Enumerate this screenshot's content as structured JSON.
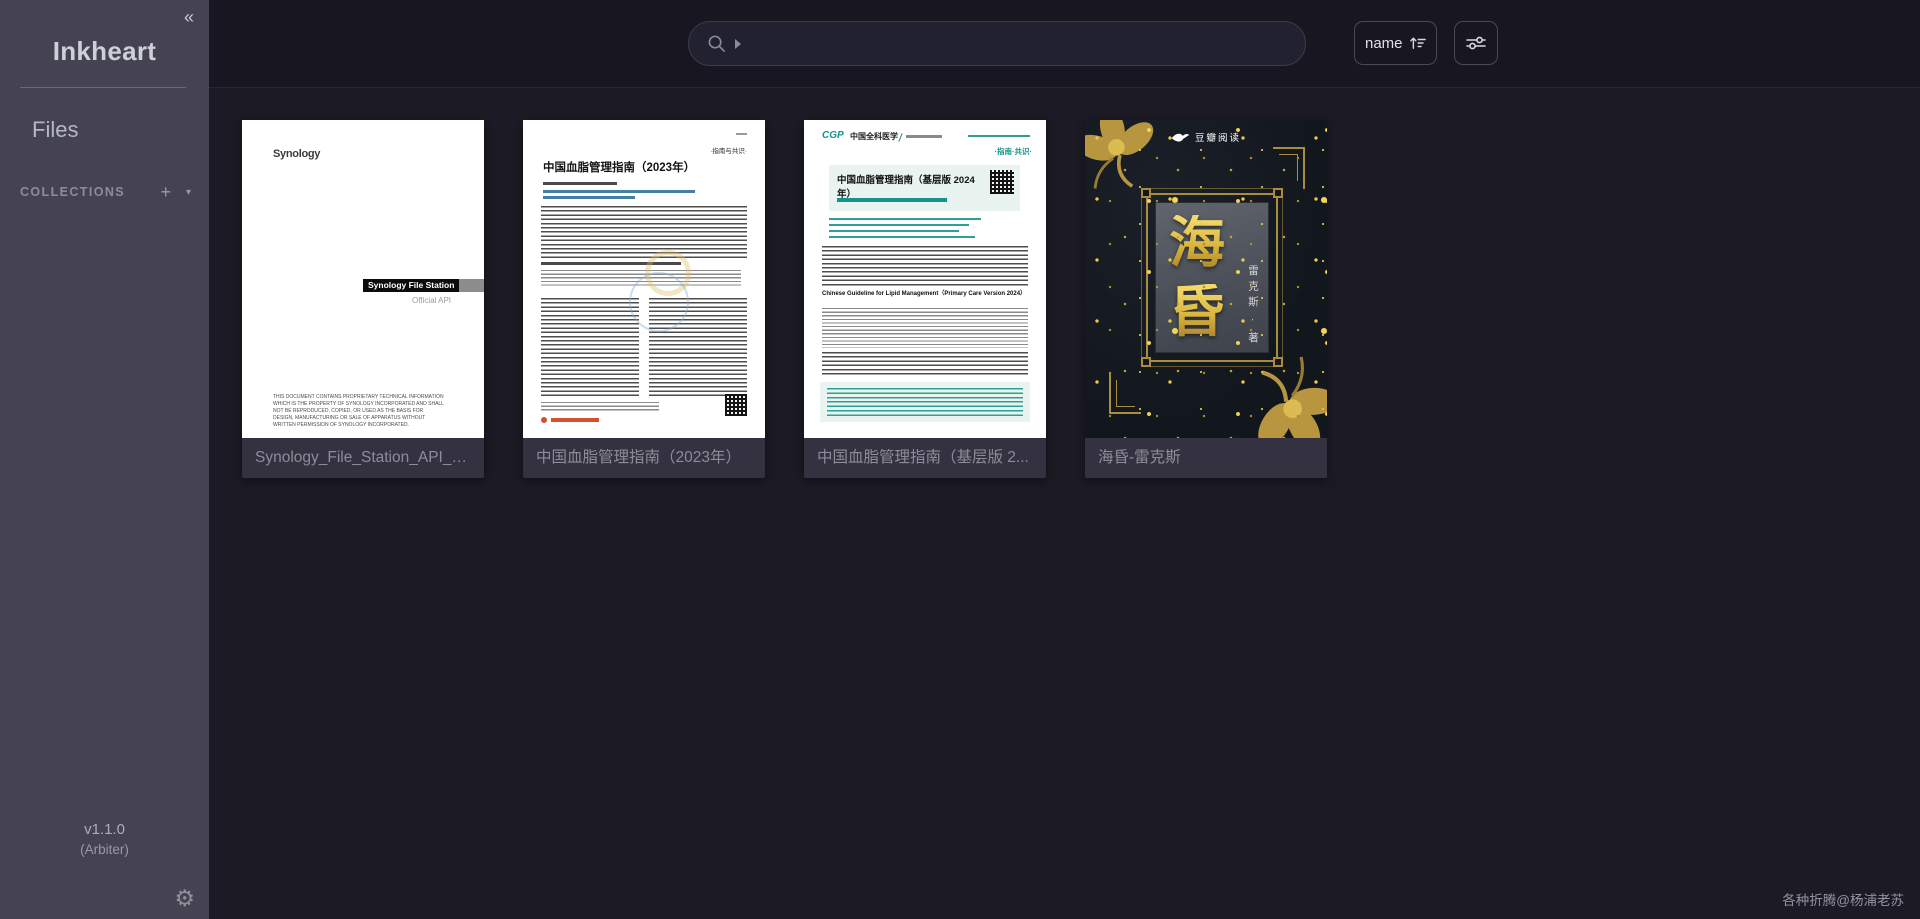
{
  "app": {
    "title": "Inkheart",
    "version": "v1.1.0",
    "edition": "(Arbiter)"
  },
  "icons": {
    "collapse": "«",
    "add": "+",
    "caret_down": "▾",
    "gear": "⚙"
  },
  "sidebar": {
    "nav_files": "Files",
    "collections_label": "COLLECTIONS"
  },
  "topbar": {
    "search_value": "",
    "sort_label": "name"
  },
  "library": {
    "cards": [
      {
        "title": "Synology_File_Station_API_G...",
        "cover": {
          "logo": "Synology",
          "banner": "Synology File Station",
          "subtitle": "Official API",
          "legal": "THIS DOCUMENT CONTAINS PROPRIETARY TECHNICAL INFORMATION WHICH IS THE PROPERTY OF SYNOLOGY INCORPORATED AND SHALL NOT BE REPRODUCED, COPIED, OR USED AS THE BASIS FOR DESIGN, MANUFACTURING OR SALE OF APPARATUS WITHOUT WRITTEN PERMISSION OF SYNOLOGY INCORPORATED."
        }
      },
      {
        "title": "中国血脂管理指南（2023年）",
        "cover": {
          "tag": "·指南与共识·",
          "doc_title": "中国血脂管理指南（2023年）"
        }
      },
      {
        "title": "中国血脂管理指南（基层版 2...",
        "cover": {
          "logo": "CGP",
          "logo_text": "中国全科医学",
          "tag": "·指南·共识·",
          "doc_title": "中国血脂管理指南（基层版 2024 年）",
          "en_title": "Chinese Guideline for Lipid Management（Primary Care Version 2024）"
        }
      },
      {
        "title": "海昏-雷克斯",
        "cover": {
          "brand": "豆瓣阅读",
          "char_top": "海",
          "char_bottom": "昏",
          "author": "雷克斯",
          "author_sep": "·",
          "author_suffix": "著"
        }
      }
    ]
  },
  "footer": {
    "watermark": "各种折腾@杨浦老苏"
  }
}
